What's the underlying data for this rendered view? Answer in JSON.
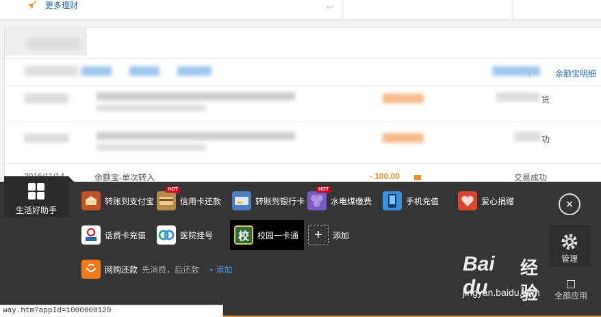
{
  "top": {
    "more_label": "更多理财"
  },
  "panel": {
    "yebao_link": "余额宝明细",
    "separator": "|",
    "right_glyph_1": "货",
    "right_glyph_2": "功",
    "row": {
      "date": "2016/11/14",
      "desc": "余额宝-单次转入",
      "amount": "- 100.00",
      "status": "交易成功"
    }
  },
  "dock": {
    "helper_label": "生活好助手",
    "apps_row1": [
      {
        "label": "转账到支付宝",
        "icon": "transfer-alipay-icon",
        "color": "#c0512a",
        "hot": false
      },
      {
        "label": "信用卡还款",
        "icon": "credit-card-icon",
        "color": "#b88a4a",
        "hot": true
      },
      {
        "label": "转账到银行卡",
        "icon": "bank-card-icon",
        "color": "#4a7fc0",
        "hot": false
      },
      {
        "label": "水电煤缴费",
        "icon": "utility-icon",
        "color": "#7b5cc4",
        "hot": true
      },
      {
        "label": "手机充值",
        "icon": "mobile-recharge-icon",
        "color": "#3a8fd8",
        "hot": false
      },
      {
        "label": "爱心捐赠",
        "icon": "donation-heart-icon",
        "color": "#d8442e",
        "hot": false
      }
    ],
    "hot_badge": "HOT",
    "apps_row2": [
      {
        "label": "话费卡充值",
        "icon": "phone-card-icon",
        "color": "#ffffff"
      },
      {
        "label": "医院挂号",
        "icon": "hospital-icon",
        "color": "#ffffff"
      },
      {
        "label": "校园一卡通",
        "icon": "campus-card-icon",
        "color": "#2f6b3a",
        "glyph": "校"
      }
    ],
    "add_label": "添加",
    "row3": {
      "label": "网购还款",
      "subtitle": "先消费，后还款",
      "add_link": "+ 添加",
      "icon": "shopping-bag-icon",
      "color": "#f07a1e"
    },
    "close_symbol": "×",
    "manage_label": "管理",
    "all_apps_label": "全部应用"
  },
  "watermark": {
    "brand": "Bai du",
    "brand_cn": "经验",
    "url": "jingyan.baidu.com"
  },
  "statusbar": {
    "text": "way.htm?appId=1000000120"
  }
}
